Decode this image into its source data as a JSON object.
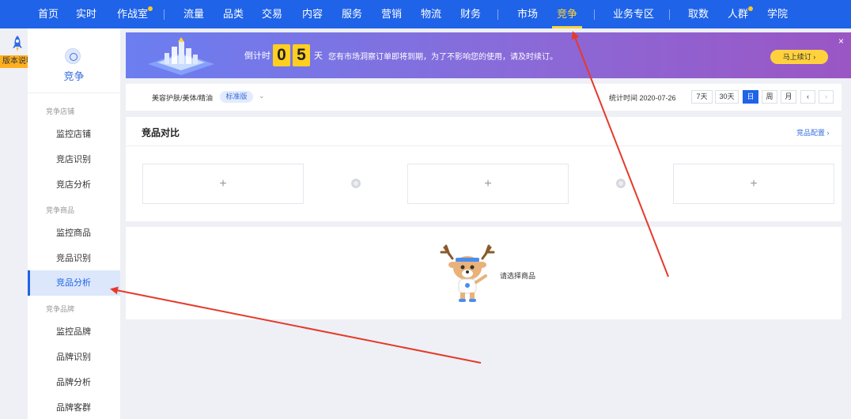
{
  "topnav": {
    "items": [
      {
        "label": "首页"
      },
      {
        "label": "实时"
      },
      {
        "label": "作战室"
      },
      {
        "label": "流量"
      },
      {
        "label": "品类"
      },
      {
        "label": "交易"
      },
      {
        "label": "内容"
      },
      {
        "label": "服务"
      },
      {
        "label": "营销"
      },
      {
        "label": "物流"
      },
      {
        "label": "财务"
      },
      {
        "label": "市场"
      },
      {
        "label": "竞争"
      },
      {
        "label": "业务专区"
      },
      {
        "label": "取数"
      },
      {
        "label": "人群"
      },
      {
        "label": "学院"
      }
    ],
    "active": "竞争",
    "accent_color": "#1f63e8",
    "active_color": "#ffd33a"
  },
  "rail": {
    "version_label": "版本说明",
    "icon": "rocket-icon"
  },
  "sidebar": {
    "title": "竞争",
    "groups": [
      {
        "label": "竞争店铺",
        "items": [
          "监控店铺",
          "竞店识别",
          "竞店分析"
        ]
      },
      {
        "label": "竞争商品",
        "items": [
          "监控商品",
          "竞品识别",
          "竞品分析"
        ]
      },
      {
        "label": "竞争品牌",
        "items": [
          "监控品牌",
          "品牌识别",
          "品牌分析",
          "品牌客群"
        ]
      }
    ],
    "active_item": "竞品分析"
  },
  "banner": {
    "countdown_label": "倒计时",
    "digits": [
      "0",
      "5"
    ],
    "unit": "天",
    "message": "您有市场洞察订单即将到期，为了不影响您的使用，请及时续订。",
    "renew_label": "马上续订 ›",
    "close": "×"
  },
  "filter": {
    "category": "美容护肤/美体/精油",
    "edition": "标准版",
    "stat_time": "统计时间 2020-07-26",
    "buttons": [
      "7天",
      "30天",
      "日",
      "周",
      "月",
      "‹",
      "›"
    ],
    "selected": "日"
  },
  "compare": {
    "title": "竞品对比",
    "config_label": "竞品配置 ›",
    "slots": [
      "+",
      "+",
      "+"
    ]
  },
  "empty": {
    "text": "请选择商品"
  },
  "annotation": {
    "arrow_color": "#e53a2b"
  }
}
